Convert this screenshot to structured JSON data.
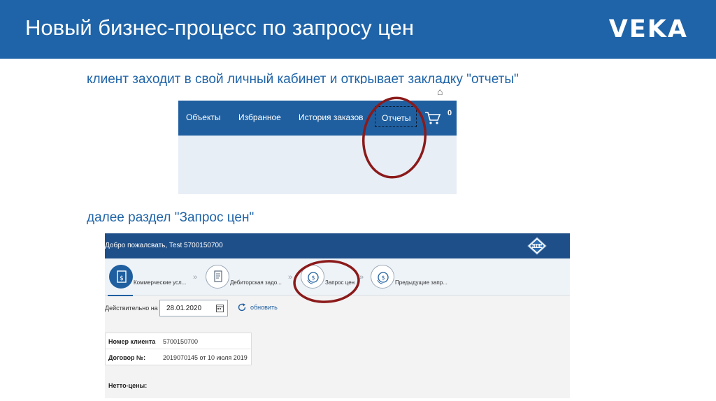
{
  "slide": {
    "title": "Новый бизнес-процесс по запросу цен",
    "brand": "VEKA",
    "caption_1": "клиент заходит в свой личный кабинет и открывает закладку \"отчеты\"",
    "caption_2": "далее раздел \"Запрос цен\""
  },
  "portal_nav": {
    "items": [
      "Объекты",
      "Избранное",
      "История заказов",
      "Отчеты"
    ],
    "cart_count": "0",
    "icons": [
      "home-icon",
      "cart-icon"
    ]
  },
  "reports_page": {
    "welcome": "Добро пожалсвать, Test 5700150700",
    "steps": [
      {
        "label": "Коммерческие усл...",
        "icon": "document-dollar-icon"
      },
      {
        "label": "Дебиторская задо...",
        "icon": "invoice-icon"
      },
      {
        "label": "Запрос цен",
        "icon": "coins-icon"
      },
      {
        "label": "Предыдущие запр...",
        "icon": "coins-icon"
      }
    ],
    "date_label": "Действительно на",
    "date_value": "28.01.2020",
    "refresh_label": "обновить",
    "info": [
      {
        "key": "Номер клиента",
        "value": "5700150700"
      },
      {
        "key": "Договор №:",
        "value": "2019070145 от 10 июля 2019"
      }
    ],
    "net_prices_label": "Нетто-цены:"
  },
  "colors": {
    "header_blue": "#1f64a8",
    "nav_blue": "#1f5fa0",
    "annotation_red": "#8b1a1a"
  }
}
